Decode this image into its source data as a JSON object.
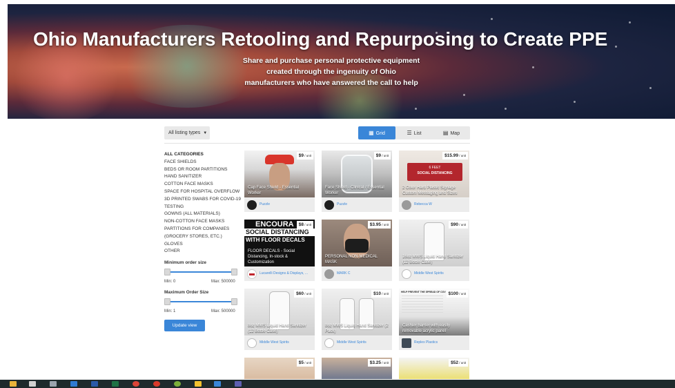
{
  "hero": {
    "title": "Ohio Manufacturers Retooling and Repurposing to Create PPE",
    "subtitle_line1": "Share and purchase personal protective equipment",
    "subtitle_line2": "created through the ingenuity of Ohio",
    "subtitle_line3": "manufacturers who have answered the call to help"
  },
  "toolbar": {
    "listing_types": "All listing types",
    "views": [
      {
        "label": "Grid",
        "icon": "grid-icon"
      },
      {
        "label": "List",
        "icon": "list-icon"
      },
      {
        "label": "Map",
        "icon": "map-icon"
      }
    ]
  },
  "sidebar": {
    "categories_heading": "ALL CATEGORIES",
    "categories": [
      "FACE SHIELDS",
      "BEDS OR ROOM PARTITIONS",
      "HAND SANITIZER",
      "COTTON FACE MASKS",
      "SPACE FOR HOSPITAL OVERFLOW",
      "3D PRINTED SWABS FOR COVID-19",
      "TESTING",
      "GOWNS (ALL MATERIALS)",
      "NON-COTTON FACE MASKS",
      "PARTITIONS FOR COMPANIES",
      "(GROCERY STORES, ETC.)",
      "GLOVES",
      "OTHER"
    ],
    "min_order": {
      "title": "Minimum order size",
      "min_label": "Min: 0",
      "max_label": "Max: 500000"
    },
    "max_order": {
      "title": "Maximum Order Size",
      "min_label": "Min: 1",
      "max_label": "Max: 500000"
    },
    "update_button": "Update view"
  },
  "listings": [
    {
      "price": "$9",
      "unit": " / unit",
      "title": "Cap Face Shield - Essential Worker",
      "seller": "Puzzle"
    },
    {
      "price": "$9",
      "unit": " / unit",
      "title": "Face Shield - Clinical / Essential Worker",
      "seller": "Puzzle"
    },
    {
      "price": "$15.99",
      "unit": " / unit",
      "title": "2 Color Hard Plastic Signage Custom Messaging and Sizes",
      "seller": "Rebecca W"
    },
    {
      "price": "$8",
      "unit": " / unit",
      "title": "FLOOR DECALS - Social Distancing, In-stock & Customization",
      "seller": "Lucarelli Designs & Displays, ..."
    },
    {
      "price": "$3.95",
      "unit": " / unit",
      "title": "PERSONAL NON-MEDICAL MASK",
      "seller": "MARK C"
    },
    {
      "price": "$90",
      "unit": " / unit",
      "title": "16oz MWS Liquid Hand Sanitizer (12 Bottle Case)",
      "seller": "Middle West Spirits"
    },
    {
      "price": "$60",
      "unit": " / unit",
      "title": "8oz MWS Liquid Hand Sanitizer (12 Bottle Case)",
      "seller": "Middle West Spirits"
    },
    {
      "price": "$10",
      "unit": " / unit",
      "title": "8oz MWS Liquid Hand Sanitizer (2 Pack)",
      "seller": "Middle West Spirits"
    },
    {
      "price": "$100",
      "unit": " / unit",
      "title": "Cashier barrier with easily removable acrylic panel",
      "seller": "Replex Plastics"
    },
    {
      "price": "$5",
      "unit": " / unit"
    },
    {
      "price": "$3.25",
      "unit": " / unit"
    },
    {
      "price": "$52",
      "unit": " / unit"
    }
  ],
  "image_text": {
    "decal_line1": "ENCOURA",
    "decal_line2": "SOCIAL DISTANCING",
    "decal_line3": "WITH FLOOR DECALS",
    "sign_line1": "6 FEET",
    "sign_line2": "SOCIAL DISTANCING",
    "barrier_header": "HELP PREVENT THE SPREAD OF COV"
  },
  "colors": {
    "accent": "#3a86d8",
    "taskbar": "#1e2a2c"
  }
}
